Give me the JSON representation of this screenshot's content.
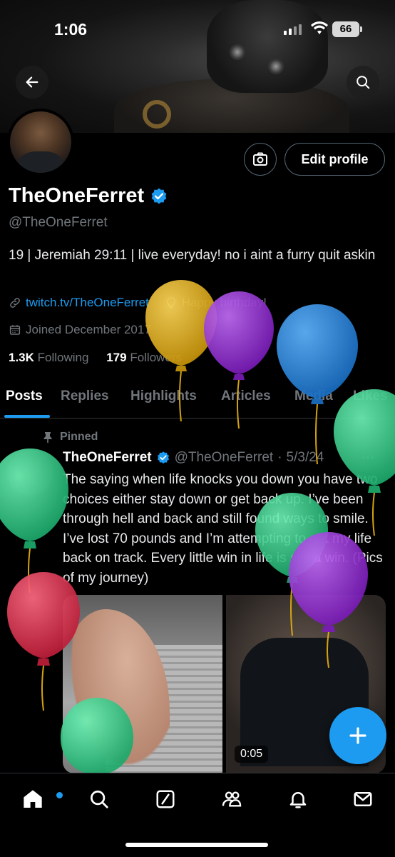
{
  "status_bar": {
    "time": "1:06",
    "battery": "66"
  },
  "profile": {
    "name": "TheOneFerret",
    "handle": "@TheOneFerret",
    "bio": "19 | Jeremiah 29:11 | live everyday! no i aint a furry quit askin",
    "link": "twitch.tv/TheOneFerret",
    "birthday": "Happy birthday!",
    "joined": "Joined December 2017",
    "following_count": "1.3K",
    "following_label": "Following",
    "followers_count": "179",
    "followers_label": "Followers",
    "edit_label": "Edit profile"
  },
  "tabs": [
    "Posts",
    "Replies",
    "Highlights",
    "Articles",
    "Media",
    "Likes"
  ],
  "post": {
    "pinned_label": "Pinned",
    "name": "TheOneFerret",
    "handle": "@TheOneFerret",
    "date": "5/3/24",
    "text": "The saying when life knocks you down you have two choices either stay down or get back up. I’ve been through hell and back and still found ways to smile. I’ve lost 70 pounds and I’m attempting to get my life back on track. Every little win in life is still a win. (Pics of my journey)",
    "video_duration": "0:05"
  },
  "icons": {
    "back": "back-arrow-icon",
    "search": "search-icon",
    "camera": "camera-icon",
    "verified": "verified-badge-icon",
    "link": "link-icon",
    "location": "location-icon",
    "calendar": "calendar-icon",
    "pin": "pin-icon",
    "compose": "plus-icon",
    "nav": [
      "home-icon",
      "search-icon",
      "grok-icon",
      "communities-icon",
      "notifications-icon",
      "messages-icon"
    ]
  },
  "colors": {
    "accent": "#1d9bf0",
    "balloon_yellow": "#e6b012",
    "balloon_purple": "#9b30d9",
    "balloon_blue": "#2a8be0",
    "balloon_green": "#2ecf8a",
    "balloon_red": "#e0344f"
  }
}
